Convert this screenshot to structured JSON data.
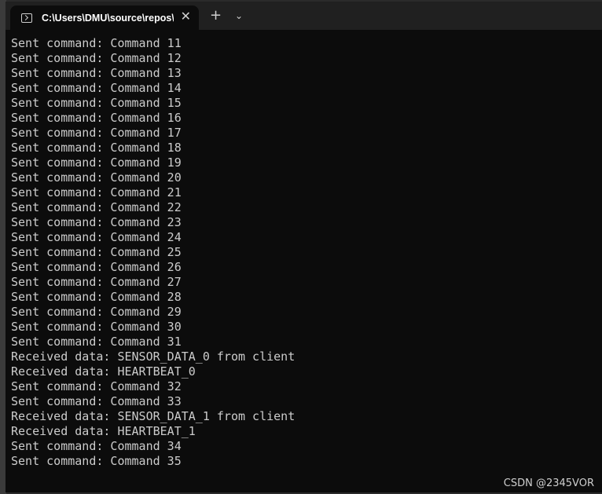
{
  "window": {
    "tab_title": "C:\\Users\\DMU\\source\\repos\\",
    "close_glyph": "✕",
    "new_tab_glyph": "+",
    "dropdown_glyph": "⌄",
    "icons": [
      "terminal-icon",
      "close-icon",
      "plus-icon",
      "chevron-down-icon"
    ]
  },
  "console": {
    "lines": [
      "Sent command: Command 11",
      "Sent command: Command 12",
      "Sent command: Command 13",
      "Sent command: Command 14",
      "Sent command: Command 15",
      "Sent command: Command 16",
      "Sent command: Command 17",
      "Sent command: Command 18",
      "Sent command: Command 19",
      "Sent command: Command 20",
      "Sent command: Command 21",
      "Sent command: Command 22",
      "Sent command: Command 23",
      "Sent command: Command 24",
      "Sent command: Command 25",
      "Sent command: Command 26",
      "Sent command: Command 27",
      "Sent command: Command 28",
      "Sent command: Command 29",
      "Sent command: Command 30",
      "Sent command: Command 31",
      "Received data: SENSOR_DATA_0 from client",
      "Received data: HEARTBEAT_0",
      "Sent command: Command 32",
      "Sent command: Command 33",
      "Received data: SENSOR_DATA_1 from client",
      "Received data: HEARTBEAT_1",
      "Sent command: Command 34",
      "Sent command: Command 35"
    ]
  },
  "watermark": "CSDN @2345VOR",
  "colors": {
    "terminal_bg": "#0c0c0c",
    "titlebar_bg": "#202020",
    "text": "#cccccc"
  }
}
